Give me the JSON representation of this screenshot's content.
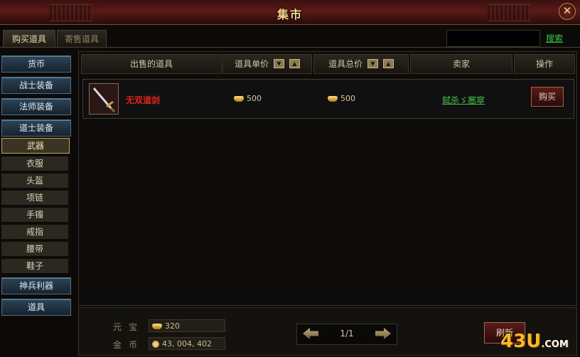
{
  "window": {
    "title": "集市",
    "close_glyph": "✕"
  },
  "tabs": [
    {
      "label": "购买道具",
      "active": true
    },
    {
      "label": "寄售道具",
      "active": false
    }
  ],
  "search": {
    "value": "",
    "button_label": "搜索"
  },
  "sidebar": {
    "categories_top": [
      "货币",
      "战士装备",
      "法师装备",
      "道士装备"
    ],
    "sub_items": [
      "武器",
      "衣服",
      "头盔",
      "项链",
      "手镯",
      "戒指",
      "腰带",
      "鞋子"
    ],
    "selected_sub": "武器",
    "categories_bottom": [
      "神兵利器",
      "道具"
    ]
  },
  "table": {
    "columns": [
      "出售的道具",
      "道具单价",
      "道具总价",
      "卖家",
      "操作"
    ],
    "rows": [
      {
        "item": "无双道剑",
        "unit_price": "500",
        "total_price": "500",
        "seller": "弑杀ゞ窸窣",
        "action": "购买"
      }
    ]
  },
  "currency": {
    "yuanbao_label": "元宝",
    "yuanbao_value": "320",
    "gold_label": "金币",
    "gold_value": "43, 004, 402"
  },
  "pager": {
    "text": "1/1"
  },
  "refresh_label": "刷新",
  "watermark": {
    "main": "43U",
    "suffix": ".COM"
  }
}
